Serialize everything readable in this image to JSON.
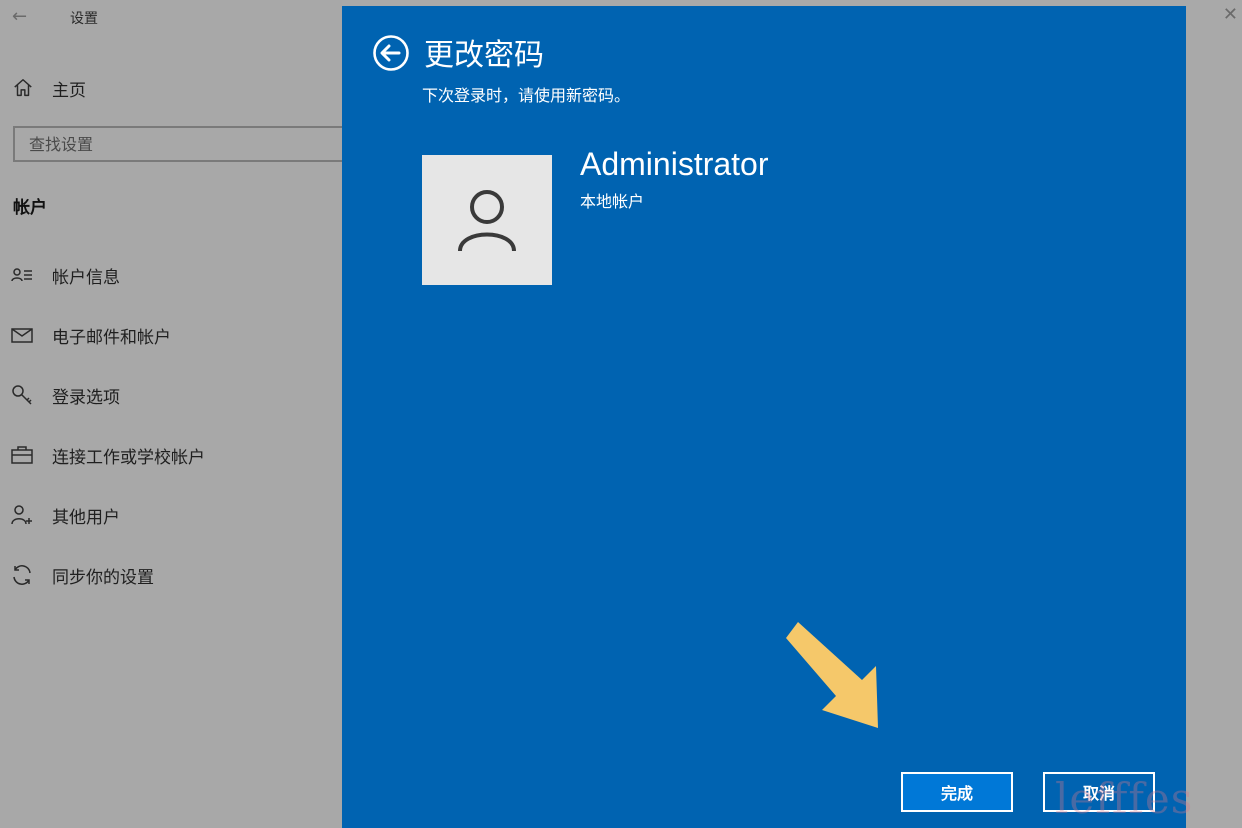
{
  "window": {
    "title": "设置",
    "back_glyph": "←",
    "close_glyph": "✕"
  },
  "sidebar": {
    "home_label": "主页",
    "search_placeholder": "查找设置",
    "section_title": "帐户",
    "items": [
      {
        "label": "帐户信息",
        "icon": "account-info-icon"
      },
      {
        "label": "电子邮件和帐户",
        "icon": "mail-icon"
      },
      {
        "label": "登录选项",
        "icon": "key-icon"
      },
      {
        "label": "连接工作或学校帐户",
        "icon": "briefcase-icon"
      },
      {
        "label": "其他用户",
        "icon": "add-person-icon"
      },
      {
        "label": "同步你的设置",
        "icon": "sync-icon"
      }
    ]
  },
  "dialog": {
    "title": "更改密码",
    "subtitle": "下次登录时，请使用新密码。",
    "user_name": "Administrator",
    "account_type": "本地帐户",
    "done_label": "完成",
    "cancel_label": "取消",
    "background_color": "#0063b1",
    "done_color": "#0078d7"
  },
  "overlay": {
    "pointer_arrow_color": "#f5c86a",
    "watermark_text": "lefffes"
  }
}
